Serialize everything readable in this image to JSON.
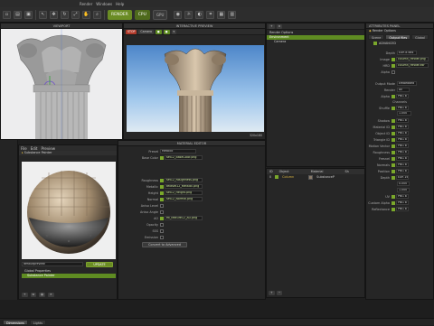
{
  "menubar": {
    "items": [
      "",
      "",
      "",
      "",
      "",
      "",
      "",
      "",
      "",
      "",
      "Render",
      "Windows",
      "Help"
    ]
  },
  "toolbar": {
    "render_label": "RENDER",
    "cpu_label": "CPU",
    "gpu_label": "GPU",
    "colors": {
      "accent": "#6a8c24"
    }
  },
  "viewport": {
    "title": "VIEWPORT"
  },
  "interactive_preview": {
    "title": "INTERACTIVE PREVIEW",
    "stop_label": "STOP",
    "camera_label": "Camera",
    "resolution": "320x180"
  },
  "render_options": {
    "tree": [
      {
        "label": "Render Options",
        "selected": false
      },
      {
        "label": "Environment",
        "selected": true
      },
      {
        "label": "Camera",
        "selected": false
      }
    ]
  },
  "file_browser": {
    "menu": [
      "File",
      "Edit",
      "Preview"
    ],
    "tree_root": "Substance Painter",
    "preset_dropdown": "defaultpreview",
    "update_label": "UPDATE",
    "materials": [
      {
        "label": "Global Properties",
        "selected": false
      },
      {
        "label": "Substance Painter",
        "selected": true
      }
    ]
  },
  "material_editor": {
    "title": "MATERIAL EDITOR",
    "preset_label": "Preset",
    "preset_value": "Metallic",
    "base_color_label": "Base Color",
    "base_color_file": "set12_BaseColor.png",
    "rows": [
      {
        "label": "Roughness",
        "value": "set12_Roughness.png"
      },
      {
        "label": "Metallic",
        "value": "textset12_Metallic.png"
      },
      {
        "label": "Height",
        "value": "set12_Height.png"
      },
      {
        "label": "Normal",
        "value": "set12_Normal.png"
      },
      {
        "label": "Aniso Level",
        "value": ""
      },
      {
        "label": "Aniso Angle",
        "value": ""
      },
      {
        "label": "AO",
        "value": "ex_texture12_AO.png"
      },
      {
        "label": "Opacity",
        "value": ""
      },
      {
        "label": "SSS",
        "value": ""
      },
      {
        "label": "Emission",
        "value": ""
      }
    ],
    "convert_button": "Convert to Advanced"
  },
  "object_list": {
    "columns": [
      "ID",
      "Object",
      "Material",
      "Sh"
    ],
    "rows": [
      {
        "id": "0",
        "object": "Column",
        "material": "SubstanceP"
      }
    ]
  },
  "attributes": {
    "title": "ATTRIBUTES PANEL",
    "subtitle": "Render Options",
    "tabs": [
      "Scene",
      "Output files",
      "Global"
    ],
    "active_tab": 1,
    "advanced_label": "ADVANCED",
    "top_rows": [
      {
        "label": "Depth",
        "value": "EXR 8 bits"
      },
      {
        "label": "Image",
        "value": "column_render.png"
      },
      {
        "label": "HRD",
        "value": "column_render.exr"
      },
      {
        "label": "Alpha",
        "value": ""
      }
    ],
    "output_mode_label": "Output Mode",
    "output_mode_value": "Embedded",
    "render_label": "Render",
    "render_value": "All",
    "alpha_label": "Alpha",
    "alpha_value": "PNG 8",
    "channels_label": "Channels",
    "shuffle_label": "Shuffle",
    "shuffle_value": "PNG 8",
    "shuffle_number": "1.000",
    "passes": [
      {
        "label": "Shadow",
        "value": "PNG 8"
      },
      {
        "label": "Material ID",
        "value": "PNG 8"
      },
      {
        "label": "Object ID",
        "value": "PNG 8"
      },
      {
        "label": "Triangle ID",
        "value": "PNG 8"
      },
      {
        "label": "Motion Vector",
        "value": "PNG 8"
      },
      {
        "label": "Roughness",
        "value": "PNG 8"
      },
      {
        "label": "Fresnel",
        "value": "PNG 8"
      },
      {
        "label": "Normals",
        "value": "PNG 8"
      },
      {
        "label": "Position",
        "value": "PNG 8"
      },
      {
        "label": "Depth",
        "value": "EXR 16bit"
      }
    ],
    "depth_numbers": [
      "0.000",
      "1.000"
    ],
    "extra_passes": [
      {
        "label": "UV",
        "value": "PNG 8"
      },
      {
        "label": "Custom Alpha",
        "value": "PNG 8"
      },
      {
        "label": "Reflectance",
        "value": "PNG 8"
      }
    ]
  },
  "bottom": {
    "tabs": [
      "Dimensions",
      "Lights"
    ]
  }
}
